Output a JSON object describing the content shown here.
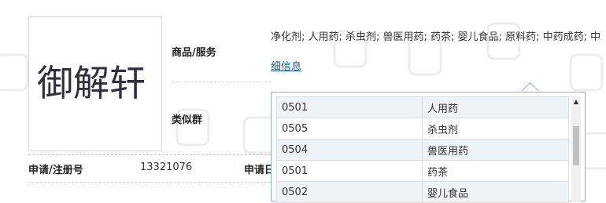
{
  "trademark": {
    "logo_text": "御解轩"
  },
  "fields": {
    "goods_label": "商品/服务",
    "goods_value": "净化剂; 人用药; 杀虫剂; 兽医用药; 药茶; 婴儿食品; 原料药; 中药成药; 中",
    "detail_link": "细信息",
    "similar_group_label": "类似群",
    "reg_no_label": "申请/注册号",
    "reg_no_value": "13321076",
    "apply_date_label": "申请日"
  },
  "popover": {
    "rows": [
      {
        "code": "0501",
        "name": "人用药"
      },
      {
        "code": "0505",
        "name": "杀虫剂"
      },
      {
        "code": "0504",
        "name": "兽医用药"
      },
      {
        "code": "0501",
        "name": "药茶"
      },
      {
        "code": "0502",
        "name": "婴儿食品"
      }
    ],
    "scroll_up_glyph": "▲"
  },
  "colors": {
    "link": "#1a5fa8",
    "popover_border": "#8fb0d4",
    "row_alt": "#eef3f8"
  }
}
